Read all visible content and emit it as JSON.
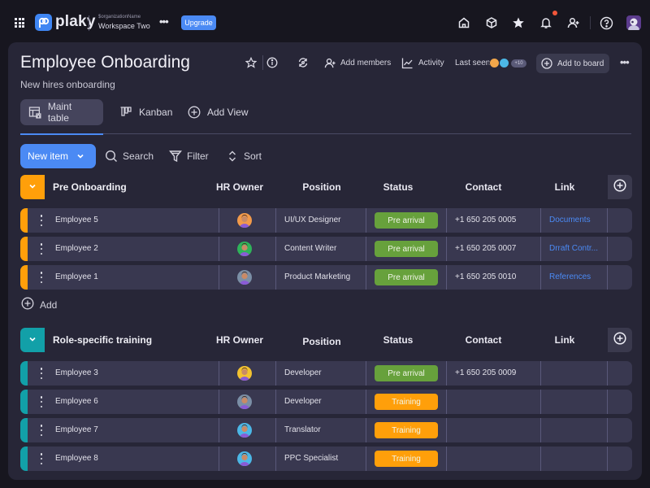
{
  "app": {
    "brand": "plaky",
    "org_label": "$organizationName",
    "workspace": "Workspace Two",
    "upgrade_label": "Upgrade",
    "icons": [
      "apps-grid-icon",
      "home-icon",
      "cube-icon",
      "star-icon",
      "bell-icon",
      "add-user-icon",
      "help-icon"
    ],
    "notification_dot_color": "#f2563a",
    "accent_color": "#4b8af4"
  },
  "board": {
    "title": "Employee Onboarding",
    "subtitle": "New hires onboarding",
    "add_members_label": "Add members",
    "activity_label": "Activity",
    "last_seen_label": "Last seen",
    "last_seen_extra": "+10",
    "add_to_board_label": "Add to board"
  },
  "tabs": [
    {
      "label": "Maint table",
      "active": true
    },
    {
      "label": "Kanban",
      "active": false
    },
    {
      "label": "Add View",
      "active": false
    }
  ],
  "toolbar": {
    "new_item_label": "New item",
    "search_label": "Search",
    "filter_label": "Filter",
    "sort_label": "Sort"
  },
  "columns": {
    "owner": "HR Owner",
    "position": "Position",
    "status": "Status",
    "contact": "Contact",
    "link": "Link"
  },
  "status_colors": {
    "Pre arrival": "#67a13c",
    "Training": "#ff9f0a"
  },
  "groups": [
    {
      "title": "Pre Onboarding",
      "color": "#ff9f0a",
      "add_label": "Add",
      "items": [
        {
          "name": "Employee 5",
          "position": "UI/UX Designer",
          "status": "Pre arrival",
          "contact": "+1 650 205 0005",
          "link": "Documents",
          "avatar_color": "#f29a4a"
        },
        {
          "name": "Employee 2",
          "position": "Content Writer",
          "status": "Pre arrival",
          "contact": "+1 650 205 0007",
          "link": "Drraft Contr...",
          "avatar_color": "#2fb35a"
        },
        {
          "name": "Employee 1",
          "position": "Product Marketing",
          "status": "Pre arrival",
          "contact": "+1 650 205 0010",
          "link": "References",
          "avatar_color": "#7b8fa6"
        }
      ]
    },
    {
      "title": "Role-specific training",
      "color": "#12a0a8",
      "items": [
        {
          "name": "Employee 3",
          "position": "Developer",
          "status": "Pre arrival",
          "contact": "+1 650 205 0009",
          "link": "",
          "avatar_color": "#f2c230"
        },
        {
          "name": "Employee 6",
          "position": "Developer",
          "status": "Training",
          "contact": "",
          "link": "",
          "avatar_color": "#7b8fa6"
        },
        {
          "name": "Employee 7",
          "position": "Translator",
          "status": "Training",
          "contact": "",
          "link": "",
          "avatar_color": "#4cb7e6"
        },
        {
          "name": "Employee 8",
          "position": "PPC Specialist",
          "status": "Training",
          "contact": "",
          "link": "",
          "avatar_color": "#4cb7e6"
        }
      ]
    }
  ]
}
